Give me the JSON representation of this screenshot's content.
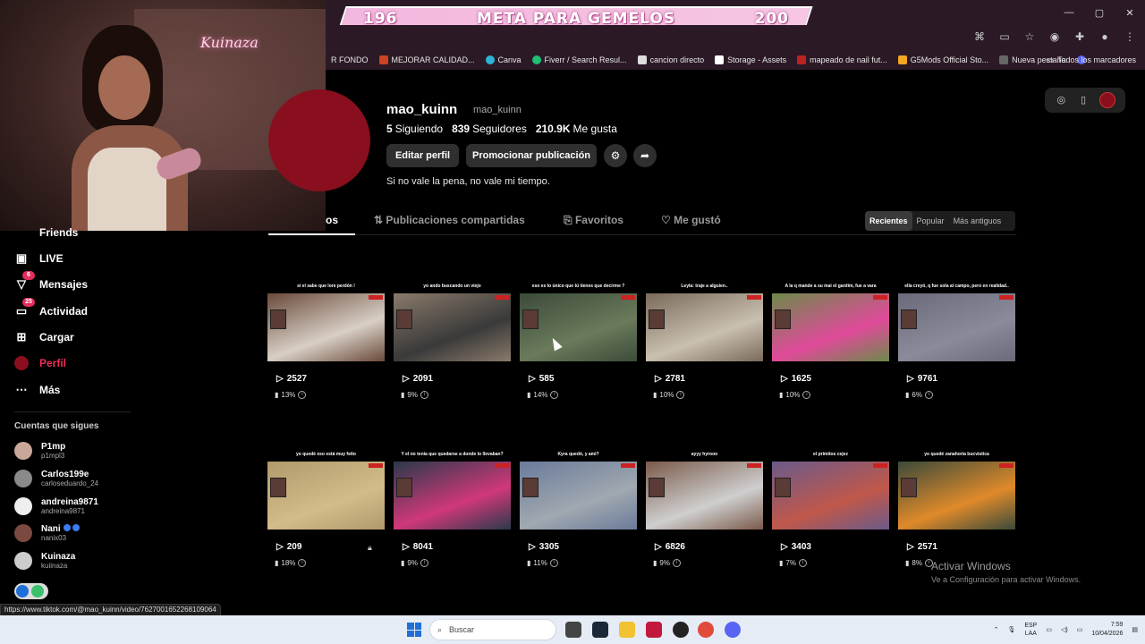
{
  "banner": {
    "left_num": "196",
    "title": "META PARA GEMELOS",
    "right_num": "200"
  },
  "window": {
    "minimize": "—",
    "maximize": "▢",
    "close": "✕"
  },
  "bookmarks": {
    "items": [
      "R FONDO",
      "MEJORAR CALIDAD...",
      "Canva",
      "Fiverr / Search Resul...",
      "cancion directo",
      "Storage - Assets",
      "mapeado de nail fut...",
      "G5Mods Official Sto...",
      "Nueva pestaña"
    ],
    "all_bookmarks": "Todos los marcadores"
  },
  "cam": {
    "sign": "Kuinaza"
  },
  "profile": {
    "username": "mao_kuinn",
    "nickname": "mao_kuinn",
    "following_count": "5",
    "following_label": "Siguiendo",
    "followers_count": "839",
    "followers_label": "Seguidores",
    "likes_count": "210.9K",
    "likes_label": "Me gusta",
    "edit_button": "Editar perfil",
    "promote_button": "Promocionar publicación",
    "bio": "Si no vale la pena, no vale mi tiempo."
  },
  "tabs": {
    "videos": "os",
    "reposts": "Publicaciones compartidas",
    "favorites": "Favoritos",
    "liked": "Me gustó"
  },
  "sort": {
    "recent": "Recientes",
    "popular": "Popular",
    "oldest": "Más antiguos"
  },
  "sidebar": {
    "friends": "Friends",
    "live": "LIVE",
    "messages": "Mensajes",
    "messages_badge": "6",
    "activity": "Actividad",
    "activity_badge": "25",
    "upload": "Cargar",
    "profile": "Perfil",
    "more": "Más",
    "following_header": "Cuentas que sigues",
    "following": [
      {
        "name": "P1mp",
        "handle": "p1mpl3"
      },
      {
        "name": "Carlos199e",
        "handle": "carloseduardo_24"
      },
      {
        "name": "andreina9871",
        "handle": "andreina9871"
      },
      {
        "name": "Nani",
        "handle": "nanix03"
      },
      {
        "name": "Kuinaza",
        "handle": "kuiinaza"
      }
    ]
  },
  "videos": [
    {
      "caption": "si el sabe que lore perdón !",
      "views": "2527",
      "pct": "13%"
    },
    {
      "caption": "yo ando buscando un viejo",
      "views": "2091",
      "pct": "9%"
    },
    {
      "caption": "eso es lo único que tú tienes que decirme ?",
      "views": "585",
      "pct": "14%"
    },
    {
      "caption": "Leyla: traje a alguien..",
      "views": "2781",
      "pct": "10%"
    },
    {
      "caption": "A la q mande a su mai el gardim, fue a vara",
      "views": "1625",
      "pct": "10%"
    },
    {
      "caption": "ella creyó, q fue sola al campo, pero en realidad..",
      "views": "9761",
      "pct": "6%"
    },
    {
      "caption": "yo quedé eso está muy feito",
      "views": "209",
      "pct": "18%"
    },
    {
      "caption": "Y el no tenia que quedarse a donde lo llevaban?",
      "views": "8041",
      "pct": "9%"
    },
    {
      "caption": "Kyra quedó, y ami?",
      "views": "3305",
      "pct": "11%"
    },
    {
      "caption": "ayyy hyrooo",
      "views": "6826",
      "pct": "9%"
    },
    {
      "caption": "el primitos cejez",
      "views": "3403",
      "pct": "7%"
    },
    {
      "caption": "yo quedé zanahoria bucvistica",
      "views": "2571",
      "pct": "8%"
    }
  ],
  "activation": {
    "title": "Activar Windows",
    "subtitle": "Ve a Configuración para activar Windows."
  },
  "status_url": "https://www.tiktok.com/@mao_kuinn/video/7627001652268109064",
  "taskbar": {
    "search": "Buscar",
    "lang1": "ESP",
    "lang2": "LAA",
    "time": "7:59",
    "date": "10/04/2026"
  }
}
